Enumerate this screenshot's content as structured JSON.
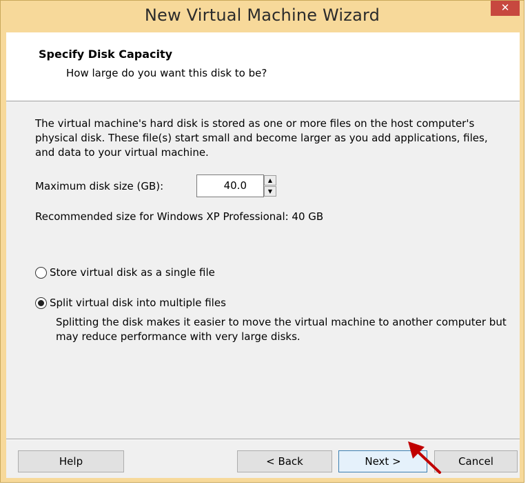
{
  "window": {
    "title": "New Virtual Machine Wizard",
    "close_glyph": "✕"
  },
  "header": {
    "title": "Specify Disk Capacity",
    "subtitle": "How large do you want this disk to be?"
  },
  "body": {
    "description": "The virtual machine's hard disk is stored as one or more files on the host computer's physical disk. These file(s) start small and become larger as you add applications, files, and data to your virtual machine.",
    "size_label": "Maximum disk size (GB):",
    "size_value": "40.0",
    "recommendation": "Recommended size for Windows XP Professional: 40 GB"
  },
  "options": {
    "single_file_label": "Store virtual disk as a single file",
    "multiple_files_label": "Split virtual disk into multiple files",
    "selected": "multiple",
    "split_description": "Splitting the disk makes it easier to move the virtual machine to another computer but may reduce performance with very large disks."
  },
  "buttons": {
    "help": "Help",
    "back": "< Back",
    "next": "Next >",
    "cancel": "Cancel"
  },
  "annotation": {
    "arrow_color": "#c00000"
  },
  "colors": {
    "titlebar": "#f7d99a",
    "close_button": "#c7483f",
    "dialog_bg": "#f0f0f0"
  }
}
